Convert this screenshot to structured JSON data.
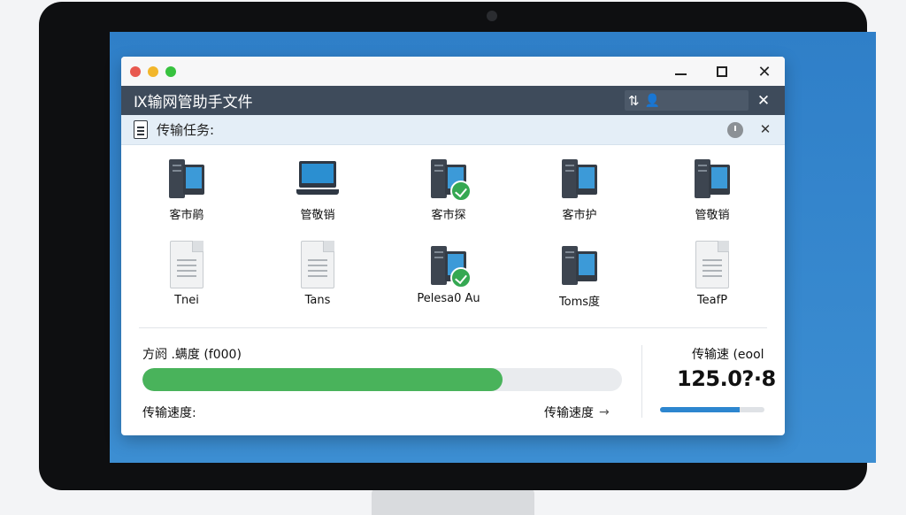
{
  "colors": {
    "close_dot": "#e8584f",
    "minimize_dot": "#f2b62b",
    "maximize_dot": "#37c23f",
    "header_bg": "#3e4b5b",
    "progress": "#49b35b",
    "rate_bar": "#2d86cf"
  },
  "app": {
    "title": "Ⅸ输网管助手文件"
  },
  "task_bar": {
    "label": "传输任务:"
  },
  "devices": [
    {
      "label": "客市鹃",
      "icon": "desktop-computer-icon",
      "status": ""
    },
    {
      "label": "管敬销",
      "icon": "laptop-icon",
      "status": ""
    },
    {
      "label": "客市探",
      "icon": "desktop-computer-icon",
      "status": "complete"
    },
    {
      "label": "客市护",
      "icon": "desktop-computer-icon",
      "status": ""
    },
    {
      "label": "管敬销",
      "icon": "desktop-computer-icon",
      "status": ""
    },
    {
      "label": "Tnei",
      "icon": "file-icon",
      "status": ""
    },
    {
      "label": "Tans",
      "icon": "file-icon",
      "status": ""
    },
    {
      "label": "Pelesa0 Au",
      "icon": "desktop-computer-icon",
      "status": "complete"
    },
    {
      "label": "Toms度",
      "icon": "desktop-computer-icon",
      "status": ""
    },
    {
      "label": "TeafP",
      "icon": "file-icon",
      "status": ""
    }
  ],
  "progress": {
    "label": "方阏 .螨度 (f000)",
    "fraction": 0.75
  },
  "speed": {
    "left_label": "传输速度:",
    "right_label": "传输速度"
  },
  "rate": {
    "label": "传输速 (eool",
    "value": "125.0?·8",
    "fraction": 0.76
  }
}
